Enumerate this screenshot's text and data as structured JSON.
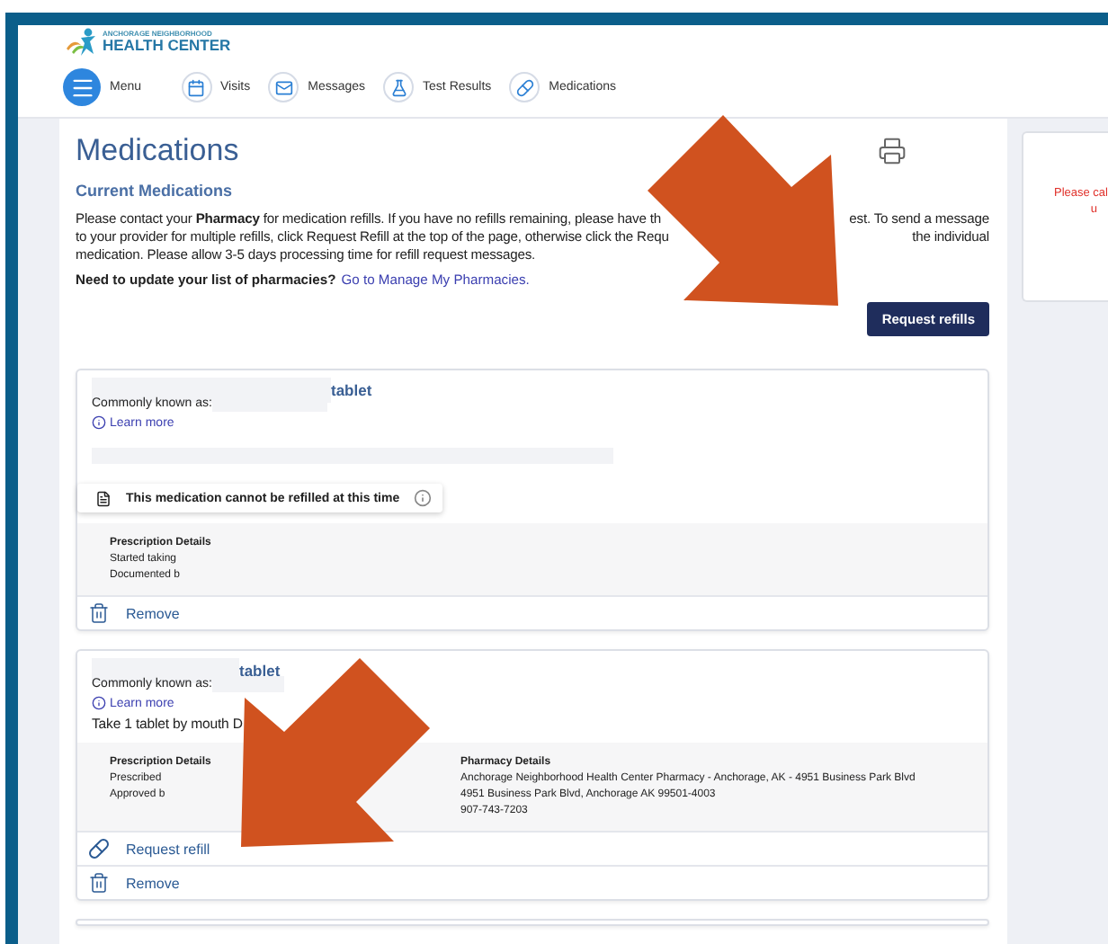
{
  "header": {
    "logo": {
      "line_1": "ANCHORAGE NEIGHBORHOOD",
      "line_2": "HEALTH CENTER"
    },
    "nav": [
      {
        "label": "Menu",
        "kind": "menu"
      },
      {
        "label": "Visits",
        "kind": "visits"
      },
      {
        "label": "Messages",
        "kind": "messages"
      },
      {
        "label": "Test Results",
        "kind": "tests"
      },
      {
        "label": "Medications",
        "kind": "medications"
      }
    ]
  },
  "page": {
    "title": "Medications",
    "section": "Current Medications",
    "intro_lines": [
      {
        "left": "Please contact your **Pharmacy** for medication refills. If you have no refills remaining, please have th",
        "right": "est. To send a message"
      },
      {
        "left": "to your provider for multiple refills, click Request Refill at the top of the page, otherwise click the Requ",
        "right": "the individual"
      },
      {
        "left": "medication. Please allow 3-5 days processing time for refill request messages."
      }
    ],
    "pharmacy_prompt": "Need to update your list of pharmacies?",
    "pharmacy_link": "Go to Manage My Pharmacies.",
    "request_button": "Request refills"
  },
  "medications": [
    {
      "name": "tablet",
      "common_label": "Commonly known as:",
      "learn_more": "Learn more",
      "notice": "This medication cannot be refilled at this time",
      "prescription": {
        "heading": "Prescription Details",
        "lines": [
          "Started taking",
          "Documented b"
        ]
      },
      "actions": [
        {
          "kind": "remove",
          "label": "Remove"
        }
      ]
    },
    {
      "name": "tablet",
      "common_label": "Commonly known as:",
      "learn_more": "Learn more",
      "sig": "Take 1 tablet by mouth D",
      "prescription": {
        "heading": "Prescription Details",
        "lines": [
          "Prescribed",
          "Approved b"
        ]
      },
      "pharmacy": {
        "heading": "Pharmacy Details",
        "lines": [
          "Anchorage Neighborhood Health Center Pharmacy - Anchorage, AK - 4951 Business Park Blvd",
          "4951 Business Park Blvd, Anchorage AK 99501-4003",
          "907-743-7203"
        ]
      },
      "actions": [
        {
          "kind": "refill",
          "label": "Request refill"
        },
        {
          "kind": "remove",
          "label": "Remove"
        }
      ]
    }
  ],
  "side_notice": {
    "lines": [
      "Please cal",
      "u"
    ]
  }
}
